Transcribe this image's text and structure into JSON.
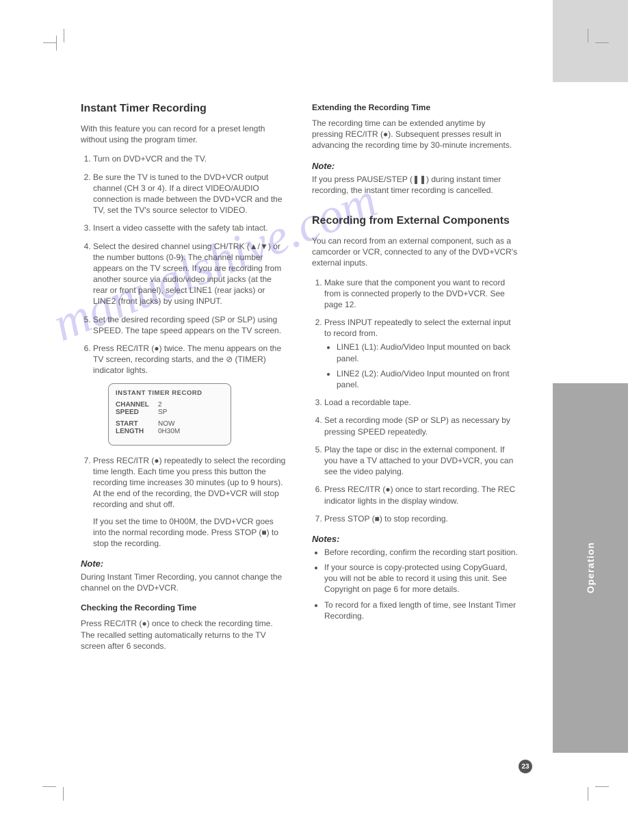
{
  "sidebar": {
    "label": "Operation"
  },
  "page_number": "23",
  "watermark": "manualshive.com",
  "left": {
    "h2": "Instant Timer Recording",
    "intro": "With this feature you can record for a preset length without using the program timer.",
    "steps": [
      "Turn on DVD+VCR and the TV.",
      "Be sure the TV is tuned to the DVD+VCR output channel (CH 3 or 4). If a direct VIDEO/AUDIO connection is made between the DVD+VCR and the TV, set the TV's source selector to VIDEO.",
      "Insert a video cassette with the safety tab intact.",
      "Select the desired channel using CH/TRK (▲/▼) or the number buttons (0-9). The channel number appears on the TV screen. If you are recording from another source via audio/video input jacks (at the rear or front panel), select LINE1 (rear jacks) or LINE2 (front jacks) by using INPUT.",
      "Set the desired recording speed (SP or SLP) using SPEED. The tape speed appears on the TV screen.",
      "Press REC/ITR (●) twice. The menu appears on the TV screen, recording starts, and the ⊘ (TIMER) indicator lights."
    ],
    "display": {
      "title": "INSTANT TIMER RECORD",
      "channel_k": "CHANNEL",
      "channel_v": "2",
      "speed_k": "SPEED",
      "speed_v": "SP",
      "start_k": "START",
      "start_v": "NOW",
      "length_k": "LENGTH",
      "length_v": "0H30M"
    },
    "step7": "Press REC/ITR (●) repeatedly to select the recording time length. Each time you press this button the recording time increases 30 minutes (up to 9 hours). At the end of the recording, the DVD+VCR will stop recording and shut off.",
    "step7b": "If you set the time to 0H00M, the DVD+VCR goes into the normal recording mode. Press STOP (■) to stop the recording.",
    "note_label": "Note:",
    "note_body": "During Instant Timer Recording, you cannot change the channel on the DVD+VCR.",
    "check_h": "Checking the Recording Time",
    "check_body": "Press REC/ITR (●) once to check the recording time. The recalled setting automatically returns to the TV screen after 6 seconds."
  },
  "right": {
    "ext_h": "Extending the Recording Time",
    "ext_body": "The recording time can be extended anytime by pressing REC/ITR (●). Subsequent presses result in advancing the recording time by 30-minute increments.",
    "note_label": "Note:",
    "note_body": "If you press PAUSE/STEP (❚❚) during instant timer recording, the instant timer recording is cancelled.",
    "h2": "Recording from External Components",
    "intro": "You can record from an external component, such as a camcorder or VCR, connected to any of the DVD+VCR's external inputs.",
    "steps": [
      "Make sure that the component you want to record from is connected properly to the DVD+VCR. See page 12.",
      "Press INPUT repeatedly to select the external input to record from.",
      "Load a recordable tape.",
      "Set a recording mode (SP or SLP) as necessary by pressing SPEED repeatedly.",
      "Play the tape or disc in the external component. If you have a TV attached to your DVD+VCR, you can see the video palying.",
      "Press REC/ITR (●) once to start recording. The REC indicator lights in the display window.",
      "Press STOP (■) to stop recording."
    ],
    "sub_bullets": [
      "LINE1 (L1): Audio/Video Input mounted on back panel.",
      "LINE2 (L2): Audio/Video Input mounted on front panel."
    ],
    "notes_label": "Notes:",
    "notes": [
      "Before recording, confirm the recording start position.",
      "If your source is copy-protected using CopyGuard, you will not be able to record it using this unit. See Copyright on page 6 for more details.",
      "To record for a fixed length of time, see Instant Timer Recording."
    ]
  }
}
